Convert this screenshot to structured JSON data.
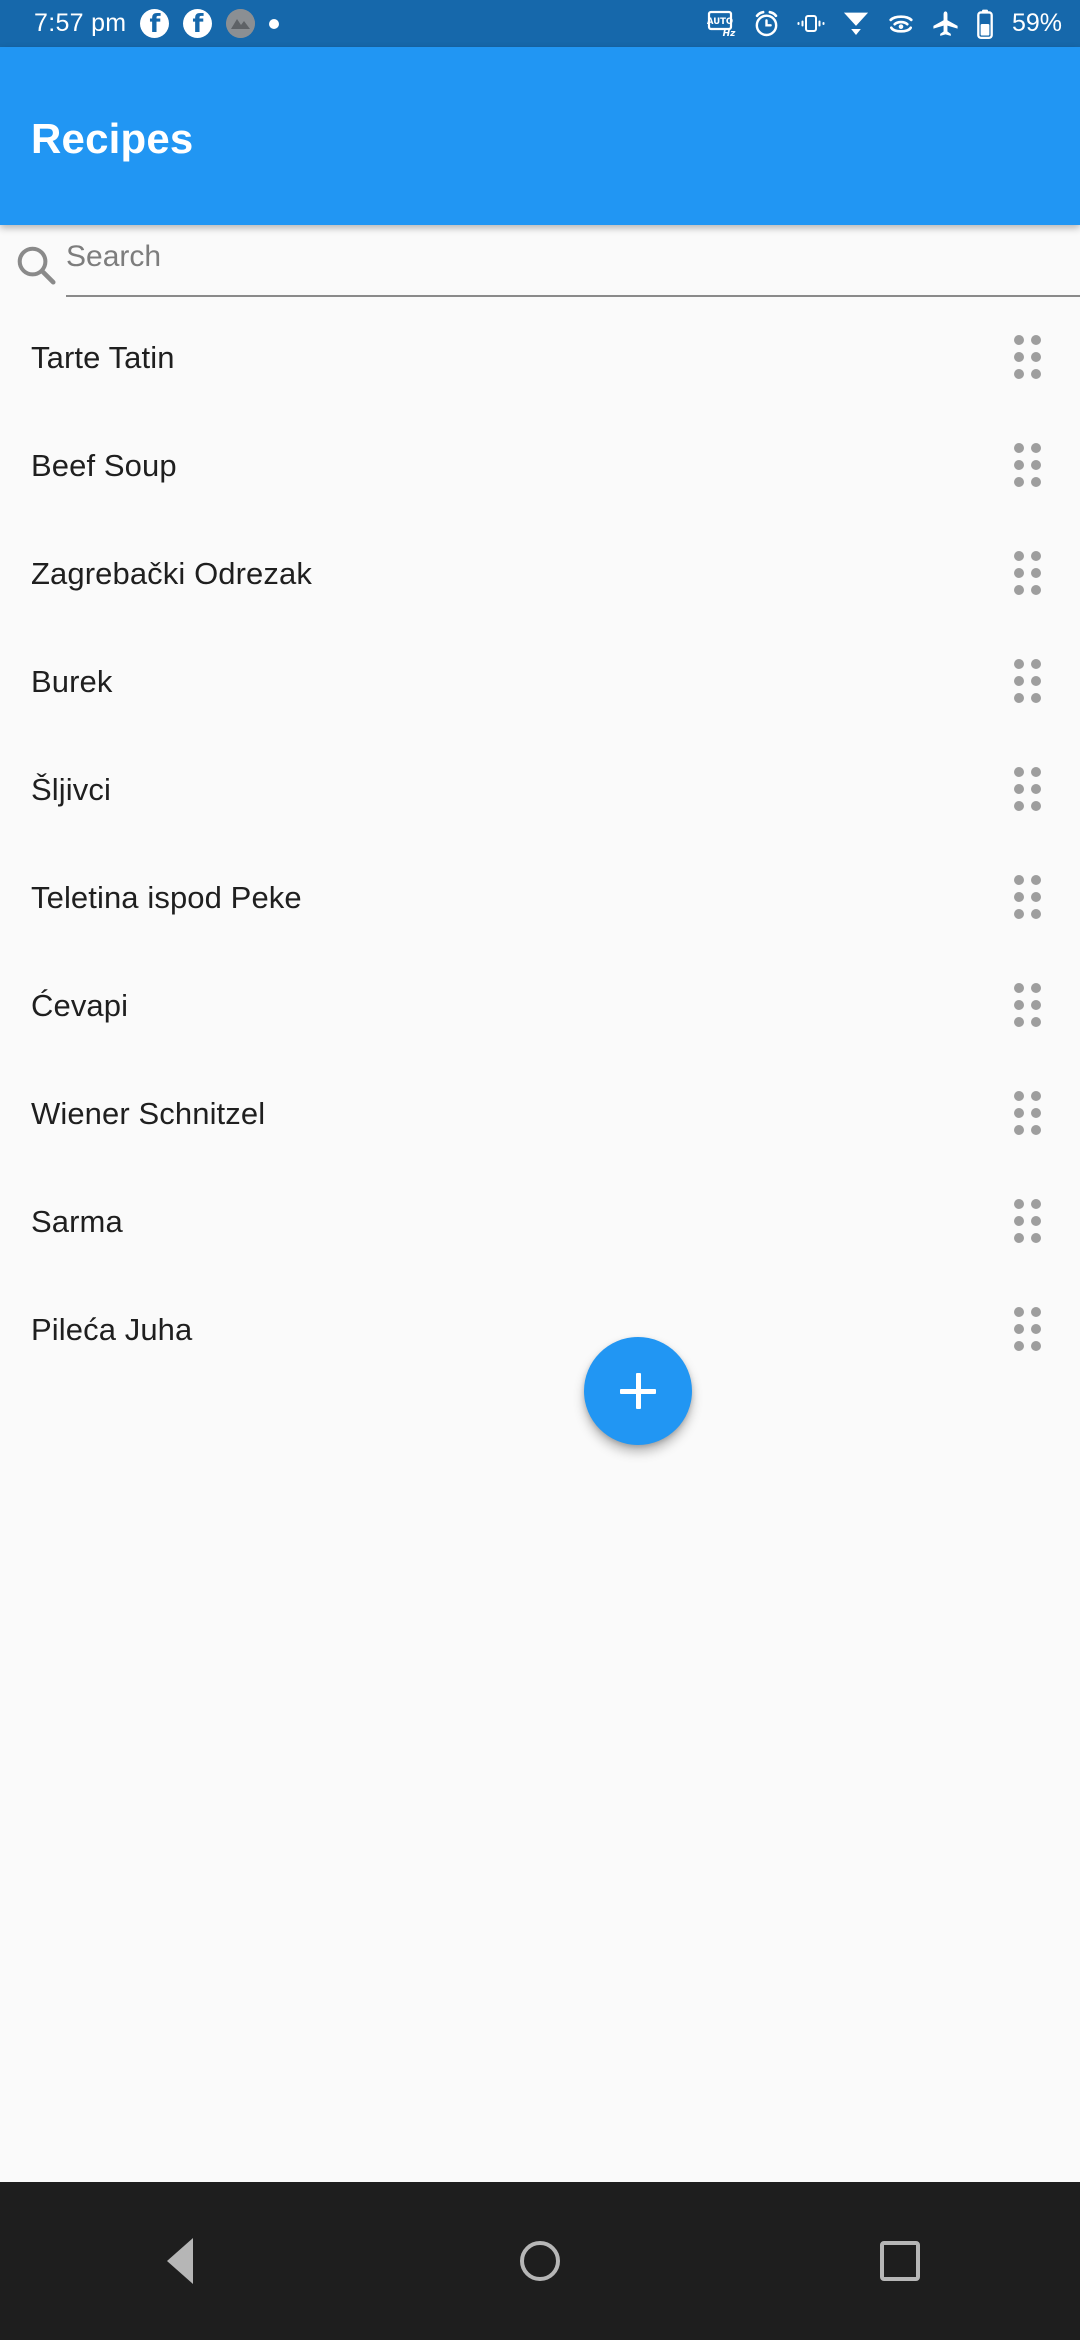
{
  "status_bar": {
    "time": "7:57 pm",
    "battery_percent": "59%",
    "left_icons": [
      {
        "name": "facebook-icon",
        "glyph": "f"
      },
      {
        "name": "facebook-icon",
        "glyph": "f"
      },
      {
        "name": "app-avatar-icon",
        "glyph": ""
      },
      {
        "name": "notification-dot-icon",
        "glyph": ""
      }
    ],
    "right_icons": [
      {
        "name": "auto-hz-icon",
        "label": "AUTO Hz"
      },
      {
        "name": "alarm-icon",
        "label": "alarm"
      },
      {
        "name": "vibrate-icon",
        "label": "vibrate"
      },
      {
        "name": "mobile-signal-icon",
        "label": "signal"
      },
      {
        "name": "wifi-icon",
        "label": "wifi"
      },
      {
        "name": "airplane-mode-icon",
        "label": "airplane mode"
      },
      {
        "name": "battery-icon",
        "label": "battery"
      }
    ],
    "colors": {
      "background": "#1668ab",
      "foreground": "#ffffff"
    }
  },
  "app_bar": {
    "title": "Recipes",
    "color": "#2196f3"
  },
  "search": {
    "placeholder": "Search",
    "value": "",
    "icon": "search-icon"
  },
  "list": {
    "items": [
      {
        "name": "Tarte Tatin"
      },
      {
        "name": "Beef Soup"
      },
      {
        "name": "Zagrebački Odrezak"
      },
      {
        "name": "Burek"
      },
      {
        "name": "Šljivci"
      },
      {
        "name": "Teletina ispod Peke"
      },
      {
        "name": "Ćevapi"
      },
      {
        "name": "Wiener Schnitzel"
      },
      {
        "name": "Sarma"
      },
      {
        "name": "Pileća Juha"
      }
    ],
    "row_handle_icon": "drag-handle-icon"
  },
  "fab": {
    "label": "+",
    "icon": "plus-icon",
    "color": "#2196f3"
  },
  "nav_bar": {
    "buttons": [
      {
        "name": "nav-back-button",
        "icon": "back-triangle-icon"
      },
      {
        "name": "nav-home-button",
        "icon": "home-circle-icon"
      },
      {
        "name": "nav-recents-button",
        "icon": "recents-square-icon"
      }
    ],
    "color": "#1e1e1e"
  }
}
